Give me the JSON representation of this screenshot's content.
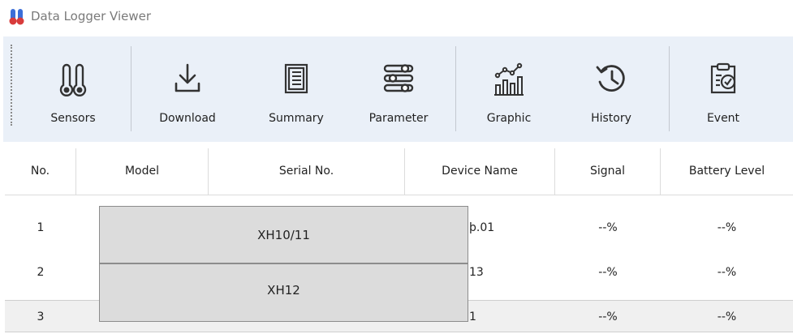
{
  "window": {
    "title": "Data Logger Viewer",
    "app_icon": "thermometer-icon"
  },
  "toolbar": {
    "buttons": [
      {
        "label": "Sensors",
        "icon": "thermometers-icon"
      },
      {
        "label": "Download",
        "icon": "download-icon"
      },
      {
        "label": "Summary",
        "icon": "document-list-icon"
      },
      {
        "label": "Parameter",
        "icon": "sliders-icon"
      },
      {
        "label": "Graphic",
        "icon": "chart-icon"
      },
      {
        "label": "History",
        "icon": "history-icon"
      },
      {
        "label": "Event",
        "icon": "event-check-icon"
      }
    ]
  },
  "table": {
    "headers": [
      "No.",
      "Model",
      "Serial No.",
      "Device Name",
      "Signal",
      "Battery Level"
    ],
    "rows": [
      {
        "no": "1",
        "model": "",
        "serial": "",
        "device": "þ.01",
        "signal": "--%",
        "battery": "--%"
      },
      {
        "no": "2",
        "model": "",
        "serial": "",
        "device": "13",
        "signal": "--%",
        "battery": "--%"
      },
      {
        "no": "3",
        "model": "",
        "serial": "",
        "device": "1",
        "signal": "--%",
        "battery": "--%"
      }
    ]
  },
  "model_dropdown": {
    "options": [
      "XH10/11",
      "XH12"
    ]
  }
}
